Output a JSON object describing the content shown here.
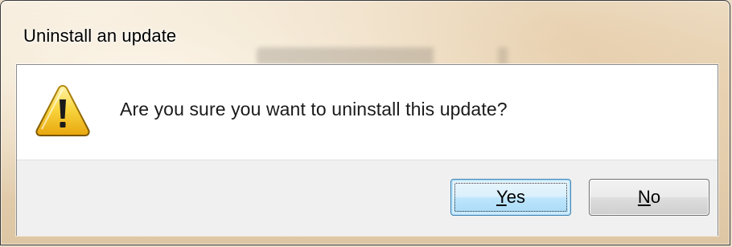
{
  "dialog": {
    "title": "Uninstall an update",
    "message": "Are you sure you want to uninstall this update?",
    "icon": "warning-icon"
  },
  "buttons": {
    "yes": {
      "label_rest": "es",
      "accelerator": "Y",
      "label": "Yes"
    },
    "no": {
      "label_rest": "o",
      "accelerator": "N",
      "label": "No"
    }
  },
  "colors": {
    "warning_fill": "#f5c518",
    "warning_outline": "#8a6a00",
    "default_button_border": "#3c7fb1",
    "button_bar": "#f0f0f0"
  }
}
